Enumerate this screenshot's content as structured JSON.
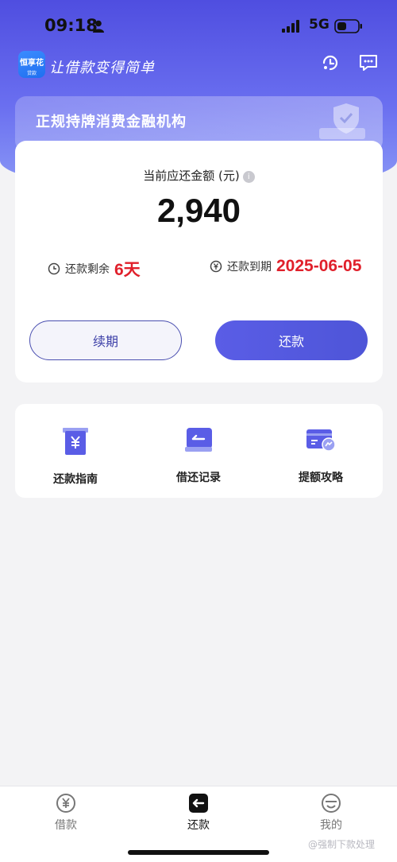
{
  "status_bar": {
    "time": "09:18",
    "network": "5G"
  },
  "header": {
    "logo_line1": "恒享花",
    "logo_line2": "贷款",
    "slogan": "让借款变得简单",
    "icons": [
      "support-icon",
      "message-icon"
    ]
  },
  "banner": {
    "text": "正规持牌消费金融机构"
  },
  "repayment_card": {
    "amount_label": "当前应还金额 (元)",
    "amount": "2,940",
    "days_left_label": "还款剩余",
    "days_left_value": "6天",
    "due_label": "还款到期",
    "due_date": "2025-06-05",
    "renew_button": "续期",
    "repay_button": "还款"
  },
  "tools": [
    {
      "label": "还款指南",
      "icon": "yuan-book-icon"
    },
    {
      "label": "借还记录",
      "icon": "record-card-icon"
    },
    {
      "label": "提额攻略",
      "icon": "credit-card-up-icon"
    }
  ],
  "tabbar": {
    "tabs": [
      {
        "label": "借款",
        "icon": "yuan-circle-icon",
        "active": false
      },
      {
        "label": "还款",
        "icon": "return-arrow-icon",
        "active": true
      },
      {
        "label": "我的",
        "icon": "smile-face-icon",
        "active": false
      }
    ]
  },
  "watermark": "@强制下款处理",
  "colors": {
    "accent": "#5a5de6",
    "highlight": "#e0202b"
  }
}
